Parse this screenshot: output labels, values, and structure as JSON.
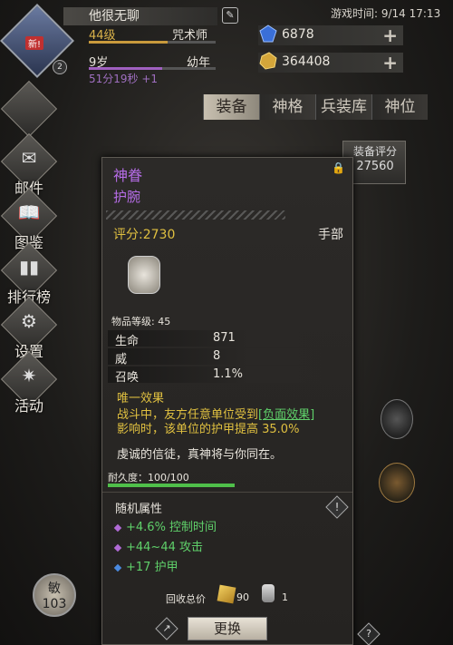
{
  "player": {
    "name": "他很无聊",
    "new_badge": "新!",
    "small_level": "2",
    "level": "44级",
    "class": "咒术师",
    "xp_progress": 0.62,
    "age": "9岁",
    "age_stage": "幼年",
    "age_progress": 0.58,
    "timer": "51分19秒 +1"
  },
  "game_time": "游戏时间: 9/14 17:13",
  "resources": [
    {
      "icon": "blue-gem-icon",
      "value": "6878"
    },
    {
      "icon": "gold-ore-icon",
      "value": "364408"
    }
  ],
  "tabs": [
    "装备",
    "神格",
    "兵装库",
    "神位"
  ],
  "active_tab": 0,
  "left_menu": [
    {
      "label": "邮件",
      "icon": "mail-icon"
    },
    {
      "label": "图鉴",
      "icon": "book-icon"
    },
    {
      "label": "排行榜",
      "icon": "ranking-icon"
    },
    {
      "label": "设置",
      "icon": "gear-icon"
    },
    {
      "label": "活动",
      "icon": "event-icon"
    }
  ],
  "power": {
    "label": "装备评分",
    "value": "27560"
  },
  "agility": {
    "label": "敏",
    "value": "103"
  },
  "item": {
    "name": "神眷",
    "type": "护腕",
    "score": "评分:2730",
    "slot": "手部",
    "item_level": "物品等级: 45",
    "stats": [
      {
        "name": "生命",
        "value": "871"
      },
      {
        "name": "威",
        "value": "8"
      },
      {
        "name": "召唤",
        "value": "1.1%"
      }
    ],
    "unique_title": "唯一效果",
    "unique_desc_pre": "战斗中，友方任意单位受到",
    "unique_desc_link": "[负面效果]",
    "unique_desc_post": "影响时，该单位的护甲提高 35.0%",
    "flavor": "虔诚的信徒，真神将与你同在。",
    "durability_label": "耐久度：100/100",
    "durability": 1.0,
    "random_title": "随机属性",
    "random_stats": [
      "+4.6% 控制时间",
      "+44~44 攻击",
      "+17 护甲"
    ],
    "recycle_label": "回收总价",
    "recycle_gold": "90",
    "recycle_item": "1",
    "swap_label": "更换"
  },
  "colors": {
    "epic": "#b56ce6",
    "gold": "#e0c040",
    "green": "#5fd06a"
  }
}
